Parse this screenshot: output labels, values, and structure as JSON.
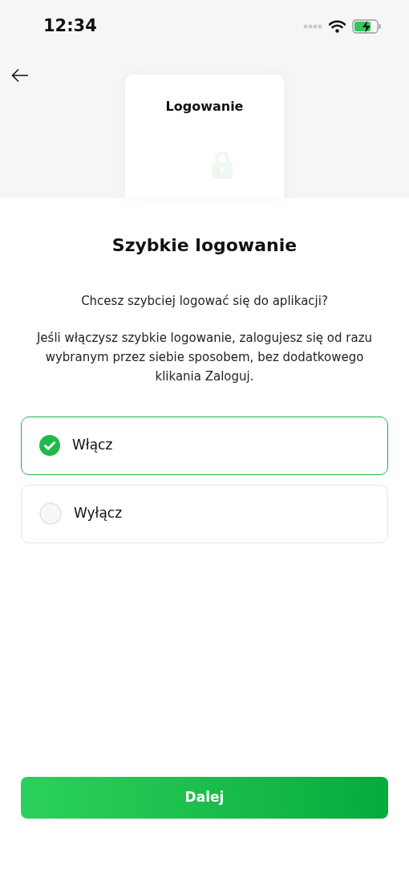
{
  "status_bar": {
    "time": "12:34"
  },
  "header_card": {
    "title": "Logowanie"
  },
  "title": "Szybkie logowanie",
  "question": "Chcesz szybciej logować się do aplikacji?",
  "description": "Jeśli włączysz szybkie logowanie, zalogujesz się od razu wybranym przez siebie sposobem, bez dodatkowego klikania Zaloguj.",
  "options": [
    {
      "label": "Włącz",
      "selected": true
    },
    {
      "label": "Wyłącz",
      "selected": false
    }
  ],
  "button": "Dalej"
}
